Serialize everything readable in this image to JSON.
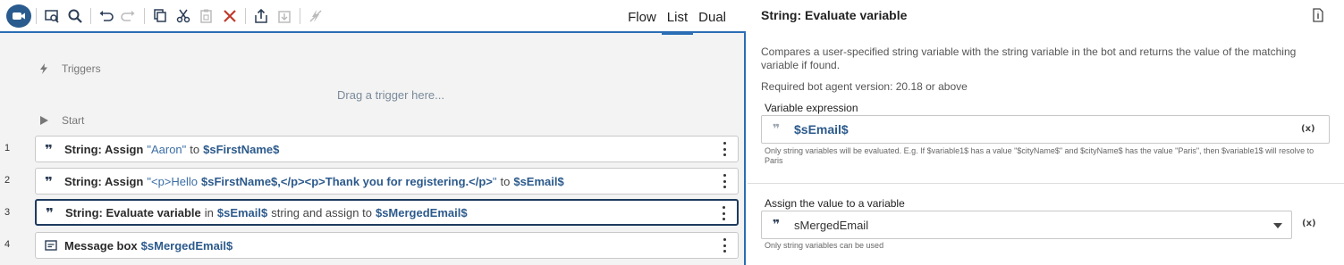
{
  "toolbar": {
    "icons": [
      "record-icon",
      "find-icon",
      "search-icon",
      "undo-icon",
      "redo-icon",
      "copy-icon",
      "cut-icon",
      "paste-icon",
      "delete-icon",
      "export-icon",
      "import-icon",
      "disable-icon"
    ]
  },
  "view_tabs": {
    "flow": "Flow",
    "list": "List",
    "dual": "Dual",
    "active": "List"
  },
  "canvas": {
    "triggers_label": "Triggers",
    "drop_hint": "Drag a trigger here...",
    "start_label": "Start",
    "rows": [
      {
        "num": "1",
        "title": "String: Assign",
        "literal": "\"Aaron\"",
        "connector": "to",
        "var": "$sFirstName$"
      },
      {
        "num": "2",
        "title": "String: Assign",
        "literal_open": "\"<p>Hello",
        "literal_var": "$sFirstName$",
        "literal_rest": ",</p><p>Thank you for registering.</p>",
        "literal_close": "\"",
        "connector": "to",
        "var": "$sEmail$"
      },
      {
        "num": "3",
        "title": "String: Evaluate variable",
        "connector1": "in",
        "var1": "$sEmail$",
        "connector2": "string and assign to",
        "var2": "$sMergedEmail$"
      },
      {
        "num": "4",
        "title": "Message box",
        "var": "$sMergedEmail$"
      }
    ]
  },
  "panel": {
    "title": "String: Evaluate variable",
    "description": "Compares a user-specified string variable with the string variable in the bot and returns the value of the matching variable if found.",
    "requirement": "Required bot agent version: 20.18 or above",
    "field1": {
      "label": "Variable expression",
      "value": "$sEmail$",
      "var_button": "(x)",
      "hint": "Only string variables will be evaluated. E.g. If $variable1$ has a value \"$cityName$\" and $cityName$ has the value \"Paris\", then $variable1$ will resolve to Paris"
    },
    "field2": {
      "label": "Assign the value to a variable",
      "value": "sMergedEmail",
      "var_button": "(x)",
      "hint": "Only string variables can be used"
    }
  },
  "colors": {
    "accent": "#2a6db5",
    "record_button": "#2a5b8e",
    "variable": "#2c5a8c",
    "delete": "#c0392b"
  }
}
